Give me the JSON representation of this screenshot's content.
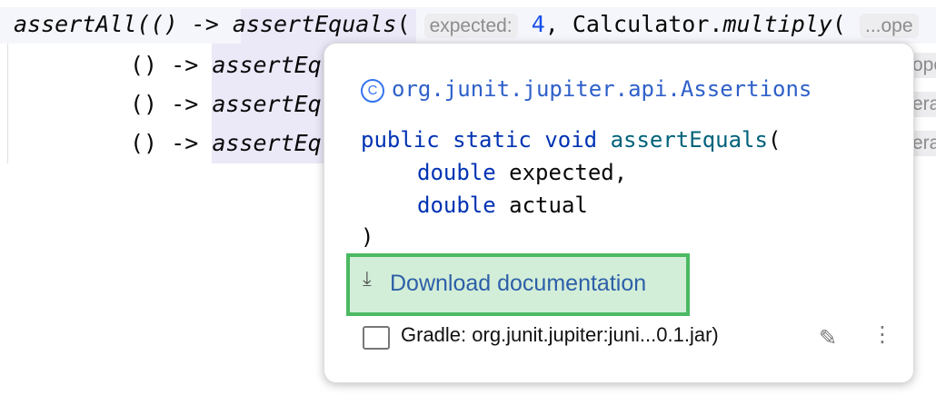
{
  "editor": {
    "line1": {
      "pre": "assertAll(() -> ",
      "method": "assertEquals",
      "paren": "(",
      "hint_expected": "expected:",
      "value": "4",
      "mid": ", Calculator.",
      "call": "multiply",
      "paren2": "(",
      "hint_more": "...ope"
    },
    "lines": [
      {
        "pre": "() -> ",
        "method": "assertEq",
        "hint": "ope"
      },
      {
        "pre": "() -> ",
        "method": "assertEq",
        "hint": "era"
      },
      {
        "pre": "() -> ",
        "method": "assertEq",
        "hint": "era"
      }
    ]
  },
  "popup": {
    "class_icon": "C",
    "class_name": "org.junit.jupiter.api.Assertions",
    "signature": {
      "mod1": "public",
      "mod2": "static",
      "ret": "void",
      "name": "assertEquals",
      "open": "(",
      "params": [
        {
          "type": "double",
          "name": "expected,"
        },
        {
          "type": "double",
          "name": "actual"
        }
      ],
      "close": ")"
    },
    "download_label": "Download documentation",
    "download_icon": "download-icon",
    "library": "Gradle: org.junit.jupiter:juni...0.1.jar)",
    "colors": {
      "highlight": "#4cb963",
      "link": "#2d5fa8"
    }
  }
}
